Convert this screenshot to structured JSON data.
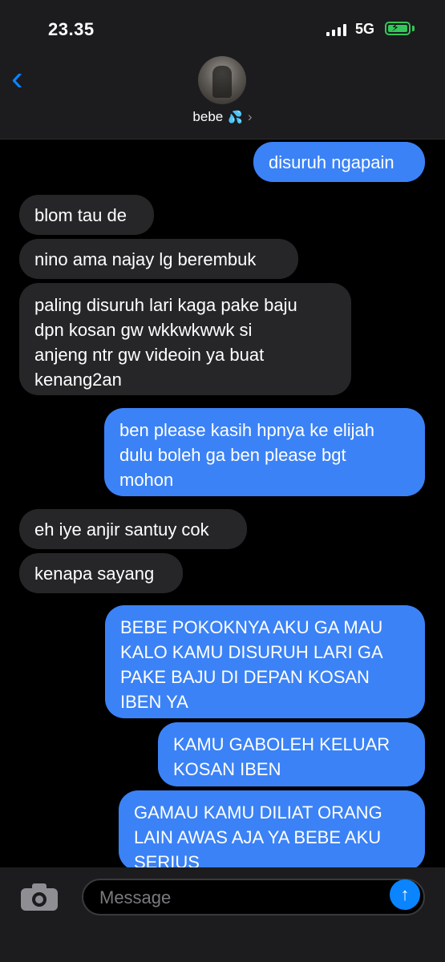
{
  "status_bar": {
    "time": "23.35",
    "network": "5G"
  },
  "header": {
    "back_icon": "chevron-left-icon",
    "contact_name": "bebe",
    "contact_emoji": "💦",
    "chevron": "›"
  },
  "messages": [
    {
      "sender": "me",
      "text": "disuruh ngapain"
    },
    {
      "sender": "them",
      "text": "blom tau de"
    },
    {
      "sender": "them",
      "text": "nino ama najay lg berembuk"
    },
    {
      "sender": "them",
      "lines": [
        "paling disuruh lari kaga pake baju",
        "dpn kosan gw wkkwkwwk si",
        "anjeng ntr gw videoin ya buat",
        "kenang2an"
      ]
    },
    {
      "sender": "me",
      "lines": [
        "ben please kasih hpnya ke elijah",
        "dulu boleh ga ben please bgt",
        "mohon"
      ]
    },
    {
      "sender": "them",
      "text": "eh iye anjir santuy cok"
    },
    {
      "sender": "them",
      "text": "kenapa sayang"
    },
    {
      "sender": "me",
      "lines": [
        "BEBE POKOKNYA AKU GA MAU",
        "KALO KAMU DISURUH LARI GA",
        "PAKE BAJU DI DEPAN KOSAN",
        "IBEN YA"
      ]
    },
    {
      "sender": "me",
      "lines": [
        "KAMU GABOLEH KELUAR",
        "KOSAN IBEN"
      ]
    },
    {
      "sender": "me",
      "lines": [
        "GAMAU KAMU DILIAT ORANG",
        "LAIN AWAS AJA YA BEBE AKU",
        "SERIUS"
      ]
    }
  ],
  "input_bar": {
    "placeholder": "Message",
    "camera_icon": "camera-icon",
    "send_icon": "arrow-up-icon",
    "send_glyph": "↑"
  },
  "colors": {
    "outgoing_bubble": "#3b82f6",
    "incoming_bubble": "#262629",
    "accent": "#0a84ff",
    "battery": "#34c759"
  }
}
